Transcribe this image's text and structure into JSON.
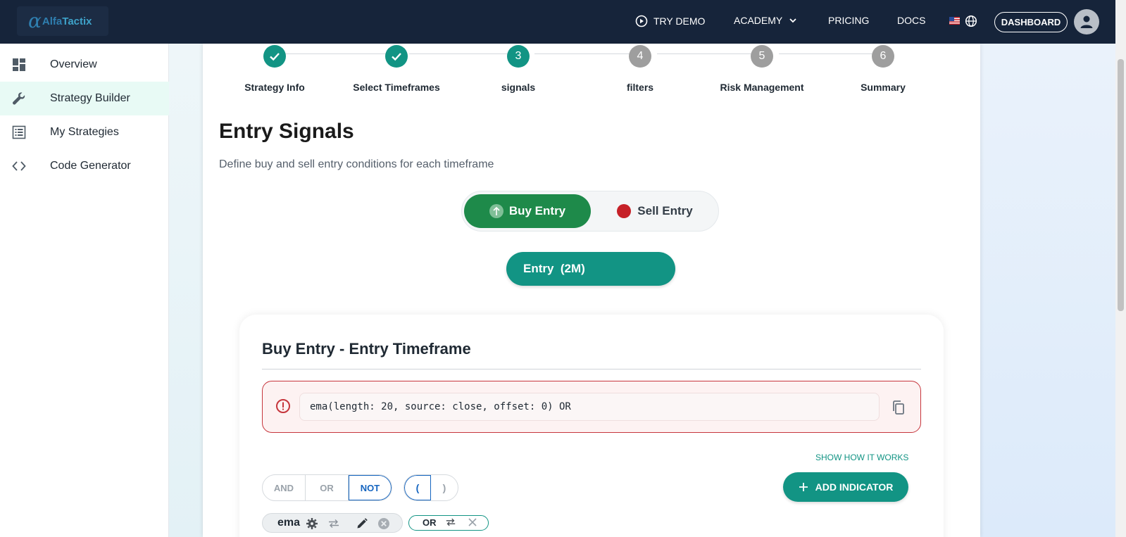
{
  "header": {
    "logo_alpha": "α",
    "logo_text_1": "Alfa",
    "logo_text_2": "Tactix",
    "nav": {
      "demo": "TRY DEMO",
      "academy": "ACADEMY",
      "pricing": "PRICING",
      "docs": "DOCS",
      "dashboard": "DASHBOARD"
    }
  },
  "sidebar": {
    "items": [
      {
        "label": "Overview",
        "icon": "dashboard-icon"
      },
      {
        "label": "Strategy Builder",
        "icon": "wrench-icon"
      },
      {
        "label": "My Strategies",
        "icon": "list-icon"
      },
      {
        "label": "Code Generator",
        "icon": "code-icon"
      }
    ],
    "active_index": 1
  },
  "stepper": {
    "steps": [
      {
        "number": "1",
        "label": "Strategy Info",
        "state": "done"
      },
      {
        "number": "2",
        "label": "Select Timeframes",
        "state": "done"
      },
      {
        "number": "3",
        "label": "signals",
        "state": "active"
      },
      {
        "number": "4",
        "label": "filters",
        "state": "todo"
      },
      {
        "number": "5",
        "label": "Risk Management",
        "state": "todo"
      },
      {
        "number": "6",
        "label": "Summary",
        "state": "todo"
      }
    ]
  },
  "main": {
    "title": "Entry Signals",
    "subtitle": "Define buy and sell entry conditions for each timeframe",
    "toggle": {
      "buy": "Buy Entry",
      "sell": "Sell Entry"
    },
    "entry_button": "Entry  (2M)",
    "section": {
      "title": "Buy Entry - Entry Timeframe",
      "expression": "ema(length: 20, source: close, offset: 0) OR",
      "how_link": "SHOW HOW IT WORKS",
      "logic": {
        "and": "AND",
        "or": "OR",
        "not": "NOT"
      },
      "parens": {
        "open": "(",
        "close": ")"
      },
      "add_indicator": "ADD INDICATOR",
      "chips": {
        "ema": "ema",
        "or": "OR"
      }
    }
  },
  "colors": {
    "topbar": "#16243a",
    "accent": "#129484",
    "buy": "#1e8a4a",
    "sell": "#c62128",
    "error": "#c6353c",
    "link_blue": "#1565c0"
  }
}
